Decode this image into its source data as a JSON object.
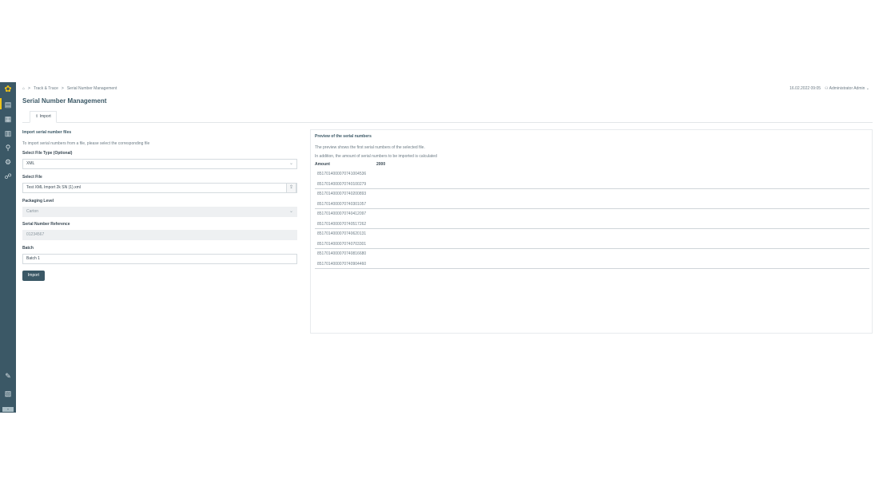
{
  "breadcrumb": {
    "home_icon": "home-icon",
    "items": [
      "Track & Trace",
      "Serial Number Management"
    ],
    "separator": ">"
  },
  "header": {
    "datetime": "16.02.2022 09:05",
    "user": "Administrator Admin"
  },
  "page": {
    "title": "Serial Number Management"
  },
  "tabs": [
    {
      "label": "Import",
      "icon": "upload-icon"
    }
  ],
  "form": {
    "section_title": "Import serial number files",
    "help": "To import serial numbers from a file, please select the corresponding file",
    "file_type": {
      "label": "Select File Type (Optional)",
      "value": "XML"
    },
    "file": {
      "label": "Select File",
      "value": "Test XML Import 2k SN (1).xml"
    },
    "packaging": {
      "label": "Packaging Level",
      "value": "Carton"
    },
    "reference": {
      "label": "Serial Number Reference",
      "value": "01234567"
    },
    "batch": {
      "label": "Batch",
      "value": "Batch 1"
    },
    "import_label": "Import"
  },
  "preview": {
    "title": "Preview of the serial numbers",
    "text1": "The preview shows the first serial numbers of the selected file.",
    "text2": "In addition, the amount of serial numbers to be imported is calculated",
    "amount_label": "Amount",
    "amount_value": "2000",
    "serials": [
      "8517014000070741004536",
      "8517014000070740100279",
      "8517014000070740200893",
      "8517014000070740301057",
      "8517014000070740412097",
      "8517014000070740517262",
      "8517014000070740620131",
      "8517014000070740703301",
      "8517014000070740816680",
      "8517014000070740904460"
    ]
  },
  "colors": {
    "sidebar": "#3b5866",
    "accent": "#f0c419",
    "primary_button": "#3b5866"
  }
}
